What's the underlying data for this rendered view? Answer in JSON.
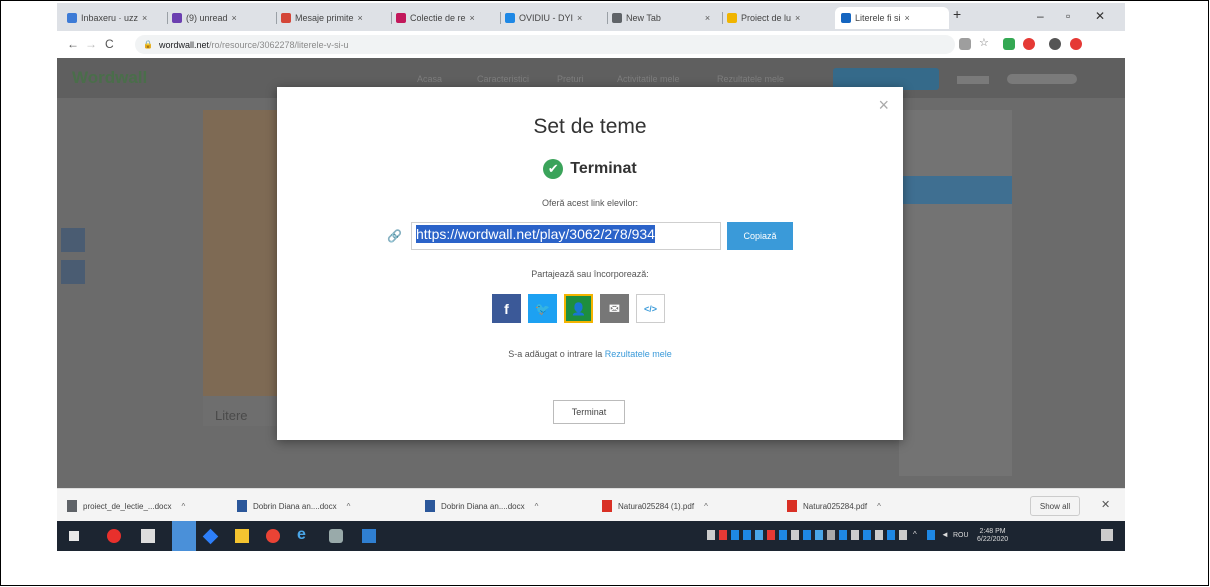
{
  "tabs": [
    {
      "label": "Inbaxeru · uzz",
      "color": "#3d7bd6"
    },
    {
      "label": "(9) unread",
      "color": "#6b3fb0"
    },
    {
      "label": "Mesaje primite",
      "color": "#d44638"
    },
    {
      "label": "Colectie de re",
      "color": "#c2185b"
    },
    {
      "label": "OVIDIU - DYI",
      "color": "#1e88e5"
    },
    {
      "label": "New Tab",
      "color": "#5f6368"
    },
    {
      "label": "Proiect de lu",
      "color": "#f0b400"
    },
    {
      "label": "Literele fi si",
      "color": "#1565c0"
    }
  ],
  "address": {
    "domain": "wordwall.net",
    "path": "/ro/resource/3062278/literele-v-si-u"
  },
  "page": {
    "logo": "Wordwall",
    "card_caption": "Litere",
    "header_links": [
      "Acasa",
      "Caracteristici",
      "Preturi",
      "Activitatile mele",
      "Rezultatele mele"
    ]
  },
  "modal": {
    "title": "Set de teme",
    "status": "Terminat",
    "offer_text": "Oferă acest link elevilor:",
    "link_value": "https://wordwall.net/play/3062/278/934",
    "copy_label": "Copiază",
    "share_label": "Partajează sau încorporează:",
    "added_text": "S-a adăugat o intrare la",
    "added_link": "Rezultatele mele",
    "done_label": "Terminat",
    "share_buttons": [
      {
        "name": "facebook",
        "glyph": "f",
        "color": "#3b5998"
      },
      {
        "name": "twitter",
        "glyph": "🐦",
        "color": "#1da1f2"
      },
      {
        "name": "classroom",
        "glyph": "👤",
        "color": "#1e8e3e"
      },
      {
        "name": "email",
        "glyph": "✉",
        "color": "#777777"
      },
      {
        "name": "embed",
        "glyph": "</>",
        "color": "#ffffff"
      }
    ]
  },
  "downloads": [
    {
      "name": "proiect_de_lectie_...docx",
      "color": "#5f6368"
    },
    {
      "name": "Dobrin Diana an....docx",
      "color": "#2b579a"
    },
    {
      "name": "Dobrin Diana an....docx",
      "color": "#2b579a"
    },
    {
      "name": "Natura025284 (1).pdf",
      "color": "#d93025"
    },
    {
      "name": "Natura025284.pdf",
      "color": "#d93025"
    }
  ],
  "downloads_show_all": "Show all",
  "taskbar": {
    "time": "2:48 PM",
    "date": "6/22/2020",
    "lang": "ROU"
  }
}
